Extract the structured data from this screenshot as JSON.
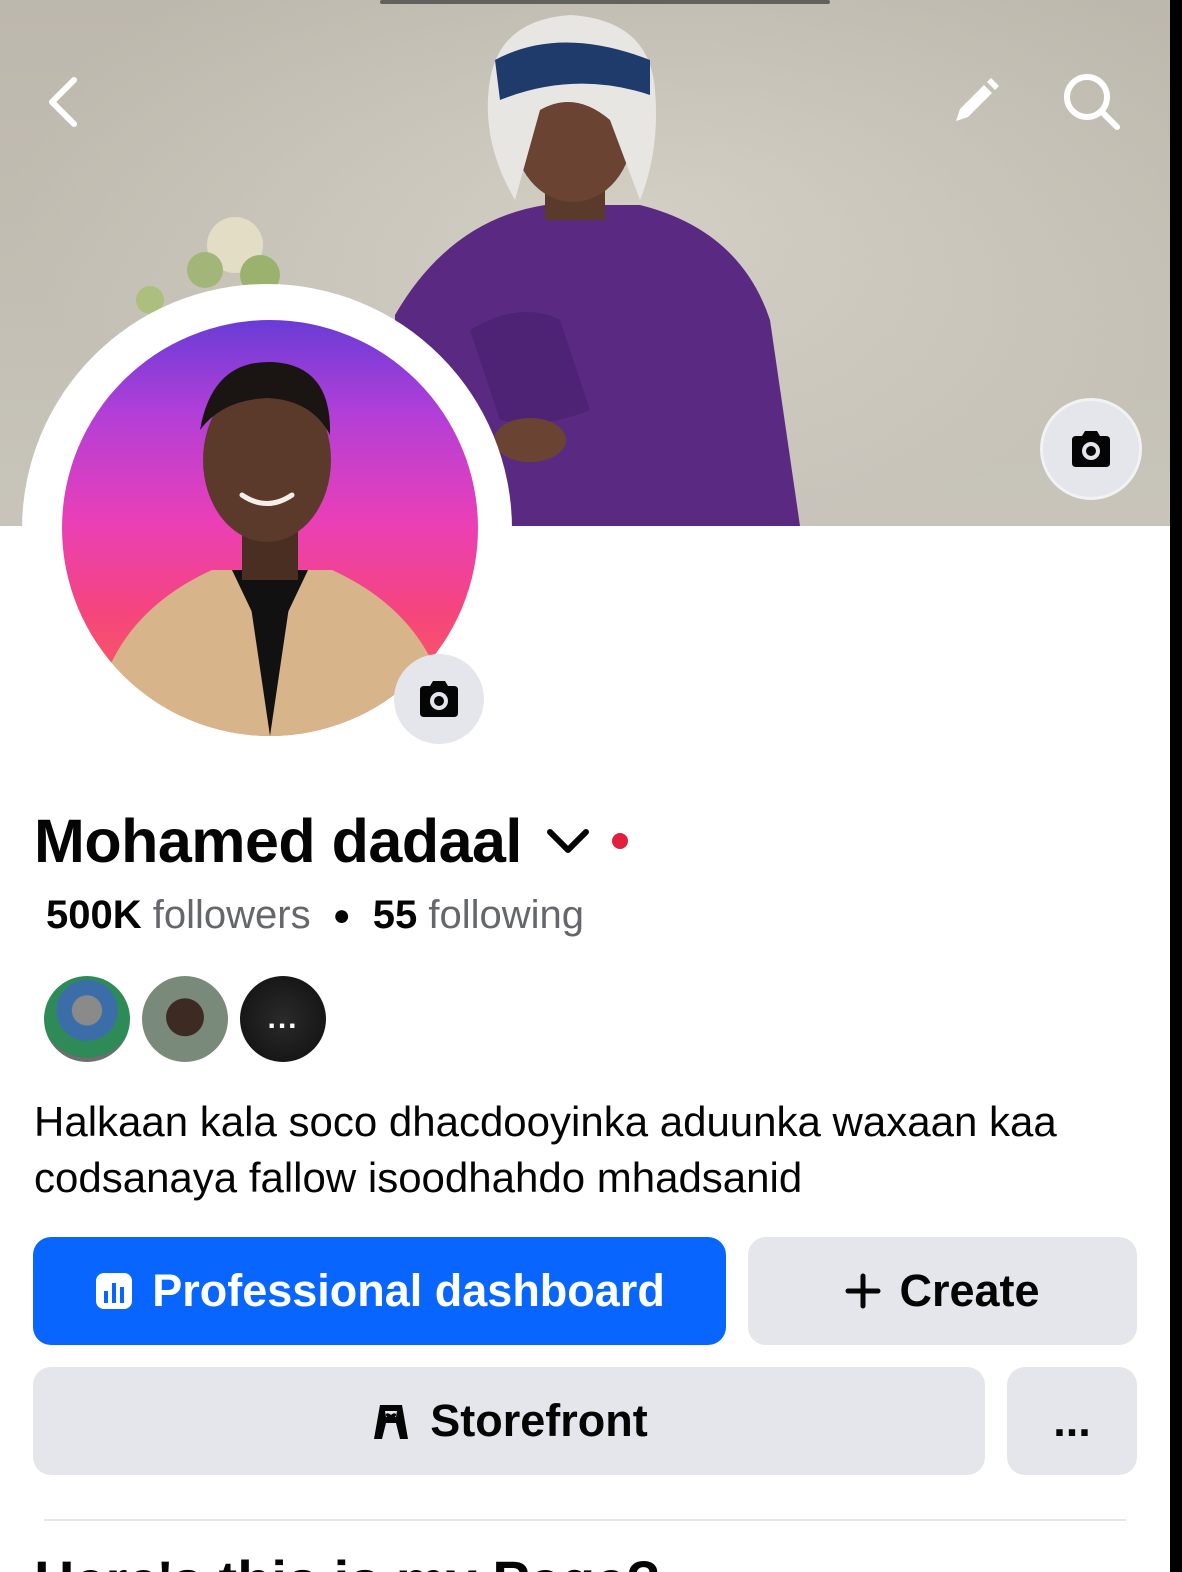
{
  "profile": {
    "name": "Mohamed dadaal",
    "followers_count": "500K",
    "followers_label": "followers",
    "following_count": "55",
    "following_label": "following",
    "bio": "Halkaan kala soco dhacdooyinka aduunka waxaan kaa codsanaya fallow isoodhahdo mhadsanid",
    "friends_more": "..."
  },
  "buttons": {
    "professional_dashboard": "Professional dashboard",
    "create": "Create",
    "storefront": "Storefront",
    "more": "..."
  },
  "next_section_partial": "Here's this is my Page?",
  "icons": {
    "back": "back-arrow-icon",
    "edit": "pencil-icon",
    "search": "search-icon",
    "camera": "camera-icon",
    "dashboard": "dashboard-icon",
    "plus": "plus-icon",
    "storefront": "storefront-icon",
    "chevron": "chevron-down-icon"
  },
  "colors": {
    "primary": "#0866ff",
    "secondary_button": "#e4e6eb",
    "status_dot": "#e41e3f"
  }
}
